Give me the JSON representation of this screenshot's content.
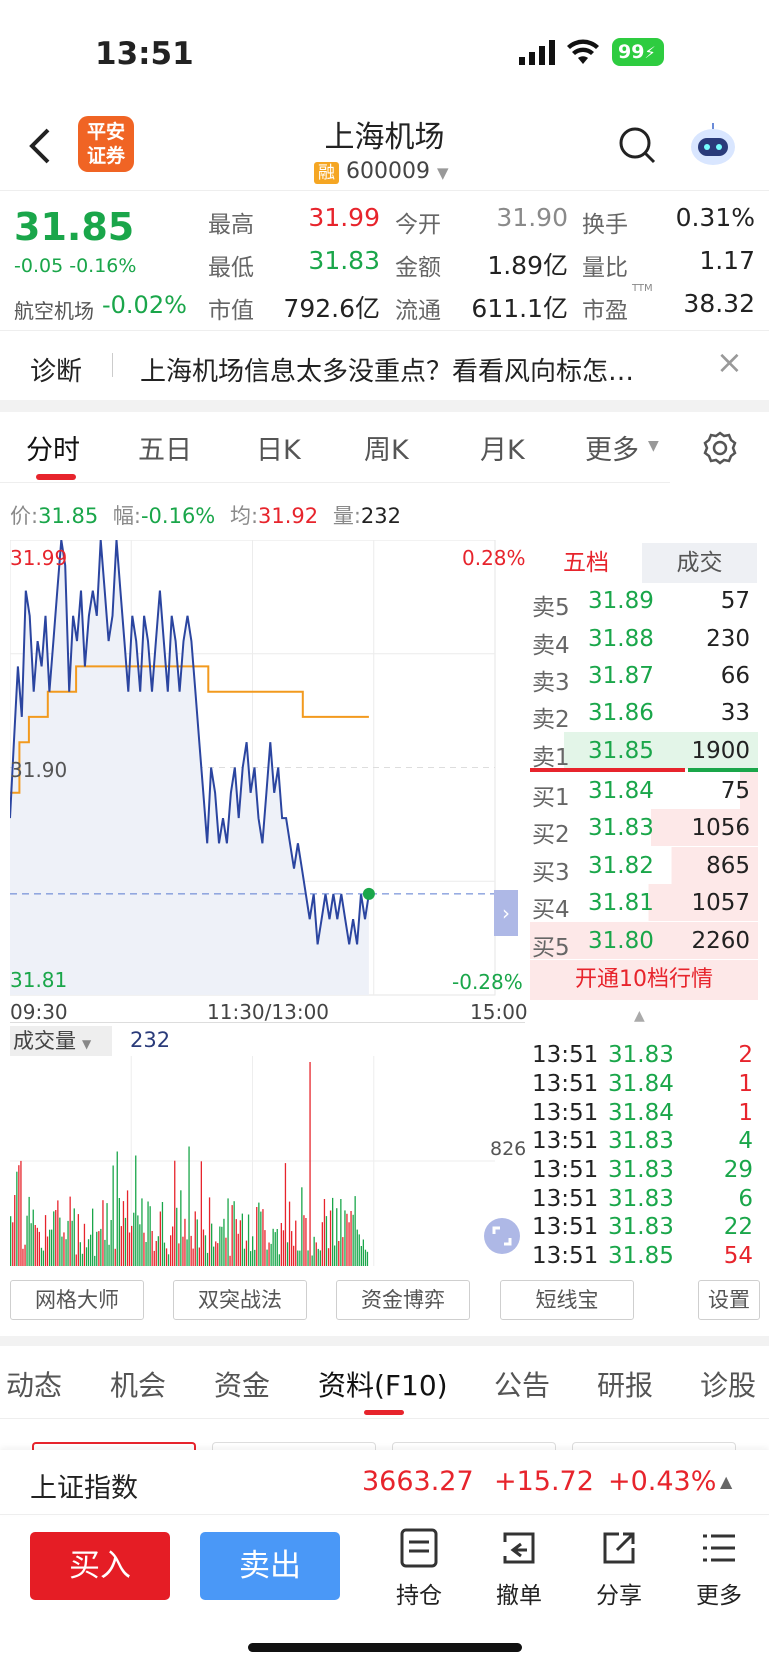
{
  "status": {
    "time": "13:51",
    "battery": "99"
  },
  "header": {
    "logo_line1": "平安",
    "logo_line2": "证券",
    "title": "上海机场",
    "margin_badge": "融",
    "code": "600009"
  },
  "quote": {
    "price": "31.85",
    "change": "-0.05",
    "change_pct": "-0.16%",
    "sector_name": "航空机场",
    "sector_pct": "-0.02%",
    "fields": [
      {
        "label": "最高",
        "value": "31.99",
        "color": "red"
      },
      {
        "label": "今开",
        "value": "31.90",
        "color": "gray"
      },
      {
        "label": "换手",
        "value": "0.31%",
        "color": "dark"
      },
      {
        "label": "最低",
        "value": "31.83",
        "color": "green"
      },
      {
        "label": "金额",
        "value": "1.89亿",
        "color": "dark"
      },
      {
        "label": "量比",
        "value": "1.17",
        "color": "dark"
      },
      {
        "label": "市值",
        "value": "792.6亿",
        "color": "dark"
      },
      {
        "label": "流通",
        "value": "611.1亿",
        "color": "dark"
      },
      {
        "label": "市盈",
        "value": "38.32",
        "color": "dark"
      }
    ],
    "pe_sup": "TTM"
  },
  "diagnosis": {
    "label": "诊断",
    "text": "上海机场信息太多没重点？看看风向标怎…"
  },
  "chart_tabs": [
    "分时",
    "五日",
    "日K",
    "周K",
    "月K",
    "更多"
  ],
  "info_line": {
    "price_label": "价:",
    "price": "31.85",
    "range_label": "幅:",
    "range": "-0.16%",
    "avg_label": "均:",
    "avg": "31.92",
    "vol_label": "量:",
    "vol": "232"
  },
  "chart_data": {
    "type": "line",
    "ylim": [
      31.81,
      31.99
    ],
    "y_ticks": [
      "31.99",
      "31.90",
      "31.81"
    ],
    "pct_ticks": [
      "0.28%",
      "-0.28%"
    ],
    "x_ticks": [
      "09:30",
      "11:30/13:00",
      "15:00"
    ],
    "series": [
      {
        "values": [
          31.88,
          31.91,
          31.94,
          31.92,
          31.97,
          31.96,
          31.93,
          31.95,
          31.94,
          31.96,
          31.93,
          31.95,
          31.97,
          31.99,
          31.98,
          31.93,
          31.96,
          31.95,
          31.97,
          31.94,
          31.96,
          31.97,
          31.96,
          31.99,
          31.97,
          31.95,
          31.96,
          31.99,
          31.97,
          31.95,
          31.93,
          31.96,
          31.95,
          31.93,
          31.96,
          31.95,
          31.93,
          31.95,
          31.97,
          31.95,
          31.93,
          31.96,
          31.95,
          31.93,
          31.95,
          31.96,
          31.95,
          31.93,
          31.91,
          31.89,
          31.87,
          31.9,
          31.89,
          31.87,
          31.88,
          31.87,
          31.89,
          31.9,
          31.88,
          31.9,
          31.91,
          31.89,
          31.9,
          31.88,
          31.87,
          31.89,
          31.91,
          31.89,
          31.9,
          31.88,
          31.88,
          31.87,
          31.86,
          31.87,
          31.86,
          31.85,
          31.84,
          31.85,
          31.83,
          31.84,
          31.85,
          31.84,
          31.85,
          31.84,
          31.85,
          31.84,
          31.83,
          31.84,
          31.83,
          31.85,
          31.84,
          31.85
        ]
      },
      {
        "values": [
          31.89,
          31.91,
          31.92,
          31.92,
          31.93,
          31.93,
          31.93,
          31.94,
          31.94,
          31.94,
          31.94,
          31.94,
          31.94,
          31.94,
          31.94,
          31.94,
          31.94,
          31.94,
          31.94,
          31.94,
          31.94,
          31.93,
          31.93,
          31.93,
          31.93,
          31.93,
          31.93,
          31.93,
          31.93,
          31.93,
          31.93,
          31.92,
          31.92,
          31.92,
          31.92,
          31.92,
          31.92,
          31.92,
          31.92
        ]
      }
    ]
  },
  "volume_panel": {
    "label": "成交量",
    "value": "232",
    "max_label": "826"
  },
  "orderbook": {
    "tab1": "五档",
    "tab2": "成交",
    "sells": [
      {
        "label": "卖5",
        "price": "31.89",
        "vol": "57"
      },
      {
        "label": "卖4",
        "price": "31.88",
        "vol": "230"
      },
      {
        "label": "卖3",
        "price": "31.87",
        "vol": "66"
      },
      {
        "label": "卖2",
        "price": "31.86",
        "vol": "33"
      },
      {
        "label": "卖1",
        "price": "31.85",
        "vol": "1900"
      }
    ],
    "buys": [
      {
        "label": "买1",
        "price": "31.84",
        "vol": "75"
      },
      {
        "label": "买2",
        "price": "31.83",
        "vol": "1056"
      },
      {
        "label": "买3",
        "price": "31.82",
        "vol": "865"
      },
      {
        "label": "买4",
        "price": "31.81",
        "vol": "1057"
      },
      {
        "label": "买5",
        "price": "31.80",
        "vol": "2260"
      }
    ],
    "open10": "开通10档行情"
  },
  "trades": [
    {
      "t": "13:51",
      "p": "31.83",
      "v": "2"
    },
    {
      "t": "13:51",
      "p": "31.84",
      "v": "1"
    },
    {
      "t": "13:51",
      "p": "31.84",
      "v": "1"
    },
    {
      "t": "13:51",
      "p": "31.83",
      "v": "4"
    },
    {
      "t": "13:51",
      "p": "31.83",
      "v": "29"
    },
    {
      "t": "13:51",
      "p": "31.83",
      "v": "6"
    },
    {
      "t": "13:51",
      "p": "31.83",
      "v": "22"
    },
    {
      "t": "13:51",
      "p": "31.85",
      "v": "54"
    }
  ],
  "tools": [
    "网格大师",
    "双突战法",
    "资金博弈",
    "短线宝",
    "设置"
  ],
  "bottom_tabs": [
    "动态",
    "机会",
    "资金",
    "资料(F10)",
    "公告",
    "研报",
    "诊股"
  ],
  "index_bar": {
    "name": "上证指数",
    "value": "3663.27",
    "change": "+15.72",
    "pct": "+0.43%"
  },
  "actions": {
    "buy": "买入",
    "sell": "卖出",
    "hold": "持仓",
    "cancel": "撤单",
    "share": "分享",
    "more": "更多"
  }
}
